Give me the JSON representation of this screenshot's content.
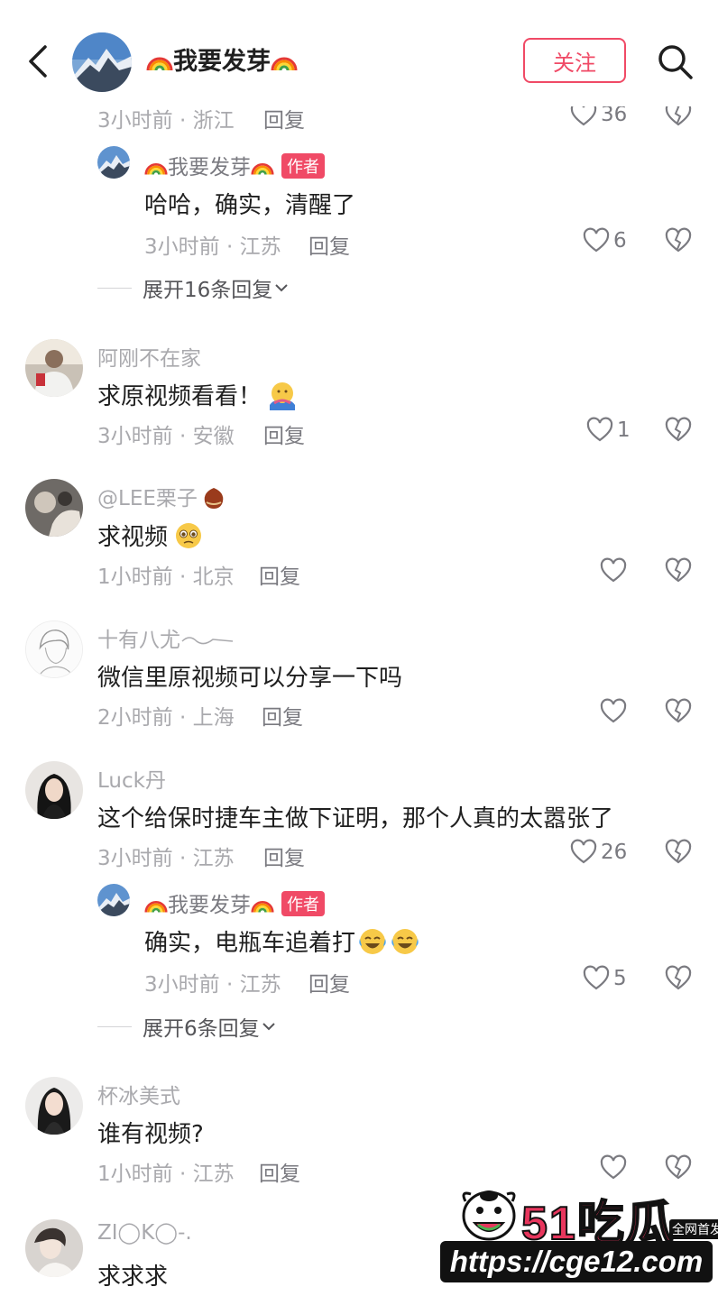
{
  "header": {
    "title": "我要发芽",
    "follow_label": "关注"
  },
  "top_partial": {
    "time_loc": "3小时前 · 浙江",
    "reply": "回复",
    "likes": "36"
  },
  "reply_a": {
    "name": "我要发芽",
    "badge": "作者",
    "text": "哈哈，确实，清醒了",
    "time_loc": "3小时前 · 江苏",
    "reply": "回复",
    "likes": "6"
  },
  "expand_a": "展开16条回复",
  "comments": [
    {
      "name": "阿刚不在家",
      "text": "求原视频看看！",
      "time_loc": "3小时前 · 安徽",
      "reply": "回复",
      "likes": "1"
    },
    {
      "name": "@LEE栗子",
      "text": "求视频",
      "time_loc": "1小时前 · 北京",
      "reply": "回复",
      "likes": ""
    },
    {
      "name": "十有八尤",
      "text": "微信里原视频可以分享一下吗",
      "time_loc": "2小时前 · 上海",
      "reply": "回复",
      "likes": ""
    },
    {
      "name": "Luck丹",
      "text": "这个给保时捷车主做下证明，那个人真的太嚣张了",
      "time_loc": "3小时前 · 江苏",
      "reply": "回复",
      "likes": "26"
    },
    {
      "name": "杯冰美式",
      "text": "谁有视频?",
      "time_loc": "1小时前 · 江苏",
      "reply": "回复",
      "likes": ""
    },
    {
      "name": "ZI◯K◯-.",
      "text": "求求求"
    }
  ],
  "reply_b": {
    "name": "我要发芽",
    "badge": "作者",
    "text": "确实，电瓶车追着打",
    "time_loc": "3小时前 · 江苏",
    "reply": "回复",
    "likes": "5"
  },
  "expand_b": "展开6条回复",
  "watermark": {
    "title": "51吃瓜",
    "tag": "全网首发",
    "url": "https://cge12.com"
  },
  "colors": {
    "accent": "#f04a66",
    "meta": "#a9a9ad",
    "text": "#1f1f1f"
  }
}
